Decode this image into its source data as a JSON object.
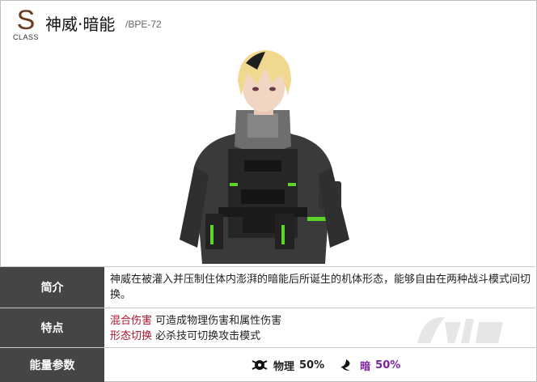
{
  "header": {
    "class_letter": "S",
    "class_word": "CLASS",
    "name": "神威·暗能",
    "code": "/BPE-72"
  },
  "rows": [
    {
      "label": "简介",
      "text": "神威在被灌入并压制住体内澎湃的暗能后所诞生的机体形态，能够自由在两种战斗模式间切换。"
    },
    {
      "label": "特点",
      "features": [
        {
          "name": "混合伤害",
          "desc": "可造成物理伤害和属性伤害"
        },
        {
          "name": "形态切换",
          "desc": "必杀技可切换攻击模式"
        }
      ]
    },
    {
      "label": "能量参数",
      "energy": [
        {
          "name": "物理",
          "value": "50%",
          "icon": "physical-icon"
        },
        {
          "name": "暗",
          "value": "50%",
          "icon": "dark-icon",
          "color": "#7b1fa2"
        }
      ]
    }
  ],
  "colors": {
    "label_bg": "#454545",
    "highlight": "#a8152e",
    "dark": "#7b1fa2",
    "class_letter": "#6b3a1f"
  }
}
